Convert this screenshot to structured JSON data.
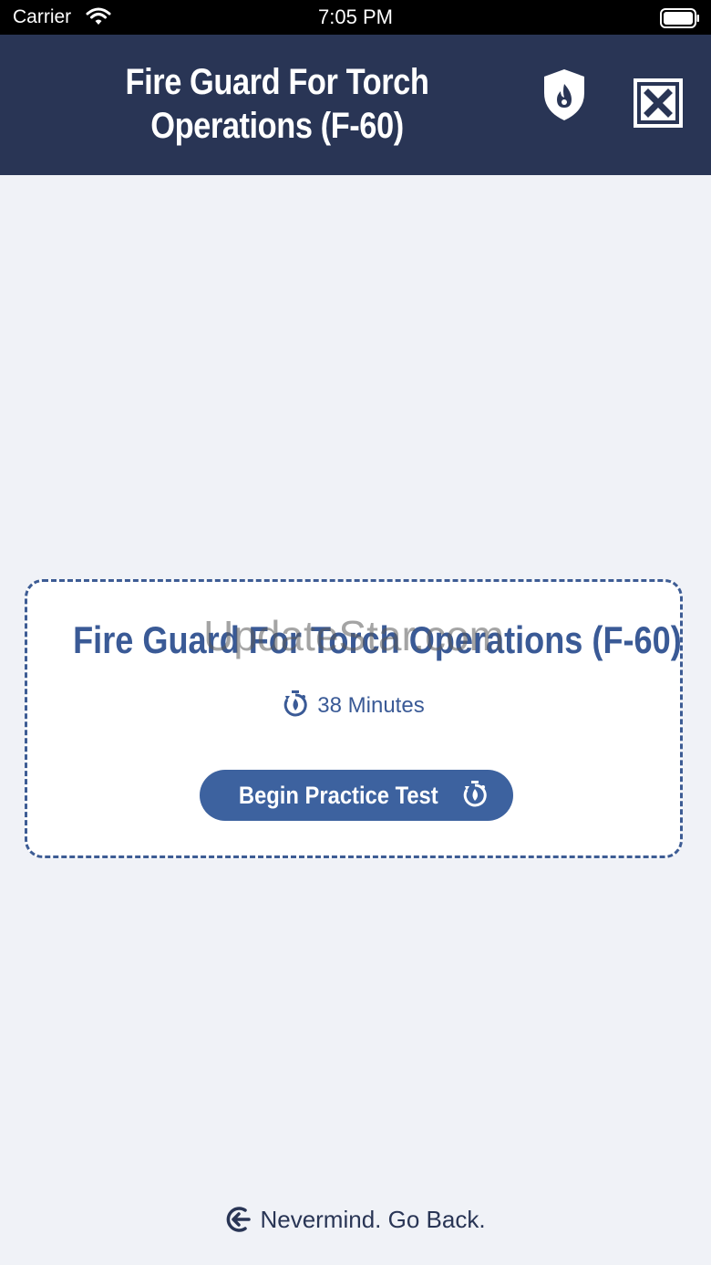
{
  "status_bar": {
    "carrier": "Carrier",
    "time": "7:05 PM",
    "icons": [
      "wifi-icon",
      "battery-icon"
    ]
  },
  "header": {
    "title": "Fire Guard For Torch Operations (F-60)",
    "icons": [
      "shield-flame-icon",
      "close-icon"
    ],
    "background": "#293555"
  },
  "card": {
    "title": "Fire Guard For Torch Operations (F-60)",
    "watermark": "UpdateStar.com",
    "duration": "38 Minutes",
    "begin_button_label": "Begin Practice Test",
    "accent": "#3d629f"
  },
  "footer": {
    "back_label": "Nevermind. Go Back."
  }
}
